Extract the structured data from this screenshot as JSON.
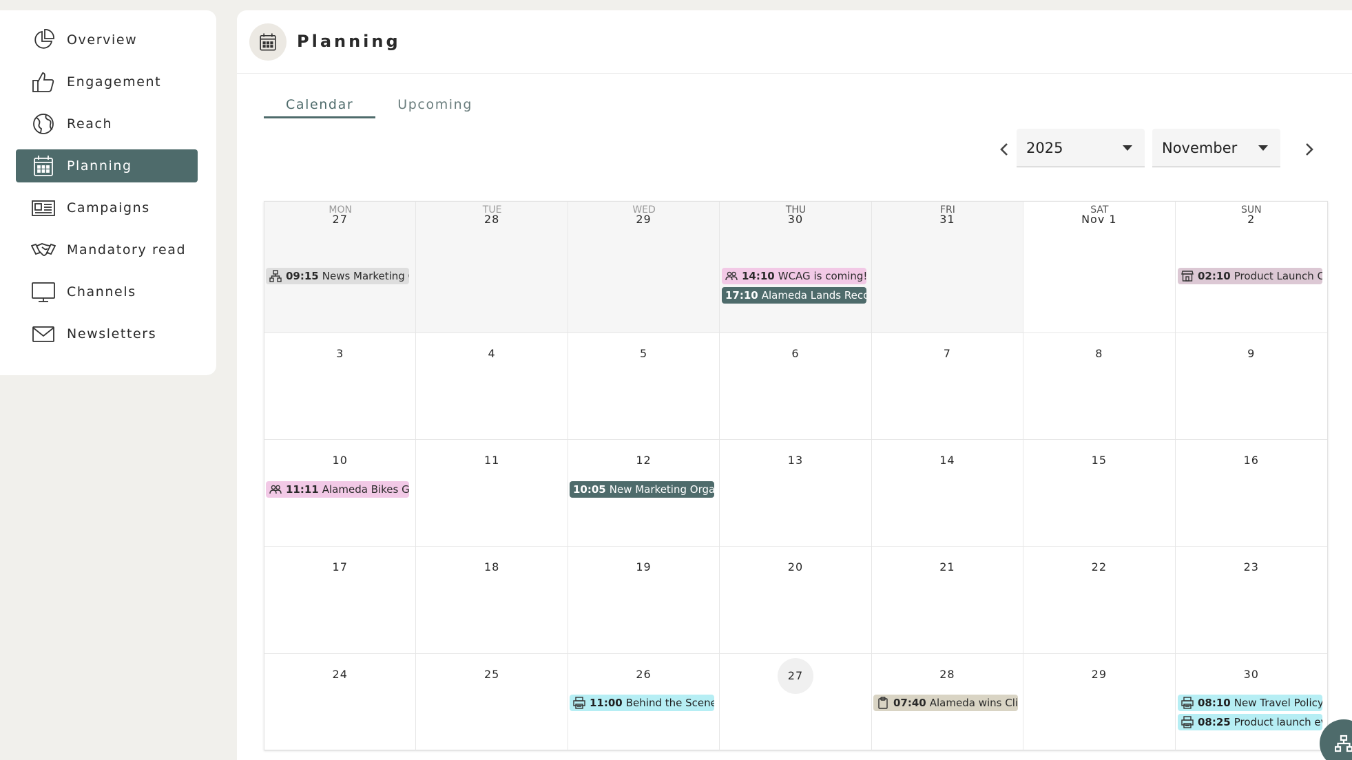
{
  "sidebar": {
    "items": [
      {
        "label": "Overview",
        "icon": "pie-chart-icon"
      },
      {
        "label": "Engagement",
        "icon": "thumbs-up-icon"
      },
      {
        "label": "Reach",
        "icon": "globe-icon"
      },
      {
        "label": "Planning",
        "icon": "calendar-icon",
        "active": true
      },
      {
        "label": "Campaigns",
        "icon": "newspaper-icon"
      },
      {
        "label": "Mandatory read",
        "icon": "handshake-icon"
      },
      {
        "label": "Channels",
        "icon": "monitor-icon"
      },
      {
        "label": "Newsletters",
        "icon": "envelope-icon"
      }
    ]
  },
  "header": {
    "title": "Planning"
  },
  "tabs": [
    {
      "label": "Calendar",
      "active": true
    },
    {
      "label": "Upcoming",
      "active": false
    }
  ],
  "controls": {
    "year": "2025",
    "month": "November"
  },
  "calendar": {
    "weekdays": [
      "MON",
      "TUE",
      "WED",
      "THU",
      "FRI",
      "SAT",
      "SUN"
    ],
    "weeks": [
      [
        "27",
        "28",
        "29",
        "30",
        "31",
        "Nov 1",
        "2"
      ],
      [
        "3",
        "4",
        "5",
        "6",
        "7",
        "8",
        "9"
      ],
      [
        "10",
        "11",
        "12",
        "13",
        "14",
        "15",
        "16"
      ],
      [
        "17",
        "18",
        "19",
        "20",
        "21",
        "22",
        "23"
      ],
      [
        "24",
        "25",
        "26",
        "27",
        "28",
        "29",
        "30"
      ]
    ],
    "today": "27",
    "events": {
      "e1": {
        "time": "09:15",
        "title": "News Marketing C"
      },
      "e2": {
        "time": "14:10",
        "title": "WCAG is coming!"
      },
      "e3": {
        "time": "17:10",
        "title": "Alameda Lands Recor"
      },
      "e4": {
        "time": "02:10",
        "title": "Product Launch C"
      },
      "e5": {
        "time": "11:11",
        "title": "Alameda Bikes Ge"
      },
      "e6": {
        "time": "10:05",
        "title": "New Marketing Organ"
      },
      "e7": {
        "time": "11:00",
        "title": "Behind the Scenes"
      },
      "e8": {
        "time": "07:40",
        "title": "Alameda wins Clir"
      },
      "e9": {
        "time": "08:10",
        "title": "New Travel Policy f"
      },
      "e10": {
        "time": "08:25",
        "title": "Product launch ev"
      }
    }
  },
  "colors": {
    "accent": "#4e6b6b",
    "pink": "#f2c9e6",
    "cyan": "#b6eef4"
  }
}
